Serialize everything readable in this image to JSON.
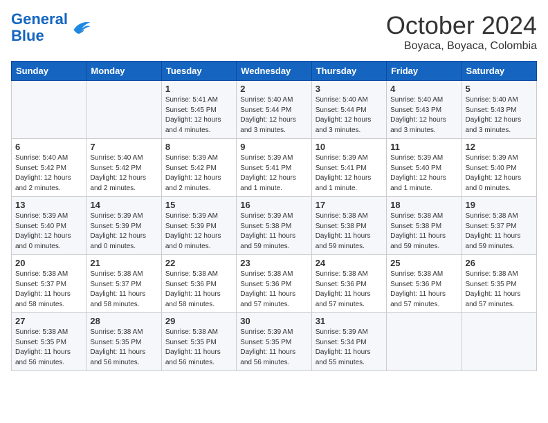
{
  "header": {
    "logo_line1": "General",
    "logo_line2": "Blue",
    "month": "October 2024",
    "location": "Boyaca, Boyaca, Colombia"
  },
  "weekdays": [
    "Sunday",
    "Monday",
    "Tuesday",
    "Wednesday",
    "Thursday",
    "Friday",
    "Saturday"
  ],
  "weeks": [
    [
      {
        "day": "",
        "detail": ""
      },
      {
        "day": "",
        "detail": ""
      },
      {
        "day": "1",
        "detail": "Sunrise: 5:41 AM\nSunset: 5:45 PM\nDaylight: 12 hours\nand 4 minutes."
      },
      {
        "day": "2",
        "detail": "Sunrise: 5:40 AM\nSunset: 5:44 PM\nDaylight: 12 hours\nand 3 minutes."
      },
      {
        "day": "3",
        "detail": "Sunrise: 5:40 AM\nSunset: 5:44 PM\nDaylight: 12 hours\nand 3 minutes."
      },
      {
        "day": "4",
        "detail": "Sunrise: 5:40 AM\nSunset: 5:43 PM\nDaylight: 12 hours\nand 3 minutes."
      },
      {
        "day": "5",
        "detail": "Sunrise: 5:40 AM\nSunset: 5:43 PM\nDaylight: 12 hours\nand 3 minutes."
      }
    ],
    [
      {
        "day": "6",
        "detail": "Sunrise: 5:40 AM\nSunset: 5:42 PM\nDaylight: 12 hours\nand 2 minutes."
      },
      {
        "day": "7",
        "detail": "Sunrise: 5:40 AM\nSunset: 5:42 PM\nDaylight: 12 hours\nand 2 minutes."
      },
      {
        "day": "8",
        "detail": "Sunrise: 5:39 AM\nSunset: 5:42 PM\nDaylight: 12 hours\nand 2 minutes."
      },
      {
        "day": "9",
        "detail": "Sunrise: 5:39 AM\nSunset: 5:41 PM\nDaylight: 12 hours\nand 1 minute."
      },
      {
        "day": "10",
        "detail": "Sunrise: 5:39 AM\nSunset: 5:41 PM\nDaylight: 12 hours\nand 1 minute."
      },
      {
        "day": "11",
        "detail": "Sunrise: 5:39 AM\nSunset: 5:40 PM\nDaylight: 12 hours\nand 1 minute."
      },
      {
        "day": "12",
        "detail": "Sunrise: 5:39 AM\nSunset: 5:40 PM\nDaylight: 12 hours\nand 0 minutes."
      }
    ],
    [
      {
        "day": "13",
        "detail": "Sunrise: 5:39 AM\nSunset: 5:40 PM\nDaylight: 12 hours\nand 0 minutes."
      },
      {
        "day": "14",
        "detail": "Sunrise: 5:39 AM\nSunset: 5:39 PM\nDaylight: 12 hours\nand 0 minutes."
      },
      {
        "day": "15",
        "detail": "Sunrise: 5:39 AM\nSunset: 5:39 PM\nDaylight: 12 hours\nand 0 minutes."
      },
      {
        "day": "16",
        "detail": "Sunrise: 5:39 AM\nSunset: 5:38 PM\nDaylight: 11 hours\nand 59 minutes."
      },
      {
        "day": "17",
        "detail": "Sunrise: 5:38 AM\nSunset: 5:38 PM\nDaylight: 11 hours\nand 59 minutes."
      },
      {
        "day": "18",
        "detail": "Sunrise: 5:38 AM\nSunset: 5:38 PM\nDaylight: 11 hours\nand 59 minutes."
      },
      {
        "day": "19",
        "detail": "Sunrise: 5:38 AM\nSunset: 5:37 PM\nDaylight: 11 hours\nand 59 minutes."
      }
    ],
    [
      {
        "day": "20",
        "detail": "Sunrise: 5:38 AM\nSunset: 5:37 PM\nDaylight: 11 hours\nand 58 minutes."
      },
      {
        "day": "21",
        "detail": "Sunrise: 5:38 AM\nSunset: 5:37 PM\nDaylight: 11 hours\nand 58 minutes."
      },
      {
        "day": "22",
        "detail": "Sunrise: 5:38 AM\nSunset: 5:36 PM\nDaylight: 11 hours\nand 58 minutes."
      },
      {
        "day": "23",
        "detail": "Sunrise: 5:38 AM\nSunset: 5:36 PM\nDaylight: 11 hours\nand 57 minutes."
      },
      {
        "day": "24",
        "detail": "Sunrise: 5:38 AM\nSunset: 5:36 PM\nDaylight: 11 hours\nand 57 minutes."
      },
      {
        "day": "25",
        "detail": "Sunrise: 5:38 AM\nSunset: 5:36 PM\nDaylight: 11 hours\nand 57 minutes."
      },
      {
        "day": "26",
        "detail": "Sunrise: 5:38 AM\nSunset: 5:35 PM\nDaylight: 11 hours\nand 57 minutes."
      }
    ],
    [
      {
        "day": "27",
        "detail": "Sunrise: 5:38 AM\nSunset: 5:35 PM\nDaylight: 11 hours\nand 56 minutes."
      },
      {
        "day": "28",
        "detail": "Sunrise: 5:38 AM\nSunset: 5:35 PM\nDaylight: 11 hours\nand 56 minutes."
      },
      {
        "day": "29",
        "detail": "Sunrise: 5:38 AM\nSunset: 5:35 PM\nDaylight: 11 hours\nand 56 minutes."
      },
      {
        "day": "30",
        "detail": "Sunrise: 5:39 AM\nSunset: 5:35 PM\nDaylight: 11 hours\nand 56 minutes."
      },
      {
        "day": "31",
        "detail": "Sunrise: 5:39 AM\nSunset: 5:34 PM\nDaylight: 11 hours\nand 55 minutes."
      },
      {
        "day": "",
        "detail": ""
      },
      {
        "day": "",
        "detail": ""
      }
    ]
  ]
}
